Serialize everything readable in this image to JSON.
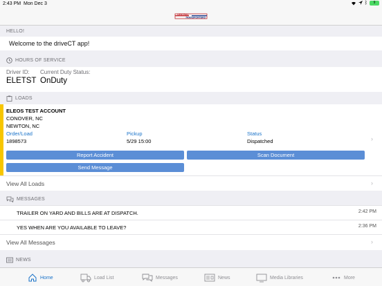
{
  "status_bar": {
    "time": "2:43 PM",
    "date": "Mon Dec 3",
    "battery": "9"
  },
  "header": {
    "logo_line1": "CENTRAL",
    "logo_line2": "TRANSPORTERS"
  },
  "hello": {
    "title": "HELLO!",
    "message": "Welcome to the driveCT app!"
  },
  "hos": {
    "title": "HOURS OF SERVICE",
    "driver_id_label": "Driver ID:",
    "driver_id": "ELETST",
    "duty_label": "Current Duty Status:",
    "duty_status": "OnDuty"
  },
  "loads": {
    "title": "LOADS",
    "account": "ELEOS TEST ACCOUNT",
    "city1": "CONOVER, NC",
    "city2": "NEWTON, NC",
    "order_label": "Order/Load",
    "order_value": "1898573",
    "pickup_label": "Pickup",
    "pickup_value": "5/29 15:00",
    "status_label": "Status",
    "status_value": "Dispatched",
    "report_accident": "Report Accident",
    "scan_document": "Scan Document",
    "send_message": "Send Message",
    "view_all": "View All Loads"
  },
  "messages": {
    "title": "MESSAGES",
    "items": [
      {
        "text": "TRAILER ON YARD AND BILLS ARE AT DISPATCH.",
        "time": "2:42 PM"
      },
      {
        "text": "YES WHEN ARE YOU AVAILABLE TO LEAVE?",
        "time": "2:36 PM"
      }
    ],
    "view_all": "View All Messages"
  },
  "news": {
    "title": "NEWS"
  },
  "tabs": [
    {
      "label": "Home",
      "icon": "home-icon"
    },
    {
      "label": "Load List",
      "icon": "truck-icon"
    },
    {
      "label": "Messages",
      "icon": "chat-icon"
    },
    {
      "label": "News",
      "icon": "newspaper-icon"
    },
    {
      "label": "Media Libraries",
      "icon": "tv-icon"
    },
    {
      "label": "More",
      "icon": "more-icon"
    }
  ],
  "colors": {
    "accent": "#1a73c9",
    "button": "#5b8ed6",
    "load_bar": "#f7c600"
  }
}
